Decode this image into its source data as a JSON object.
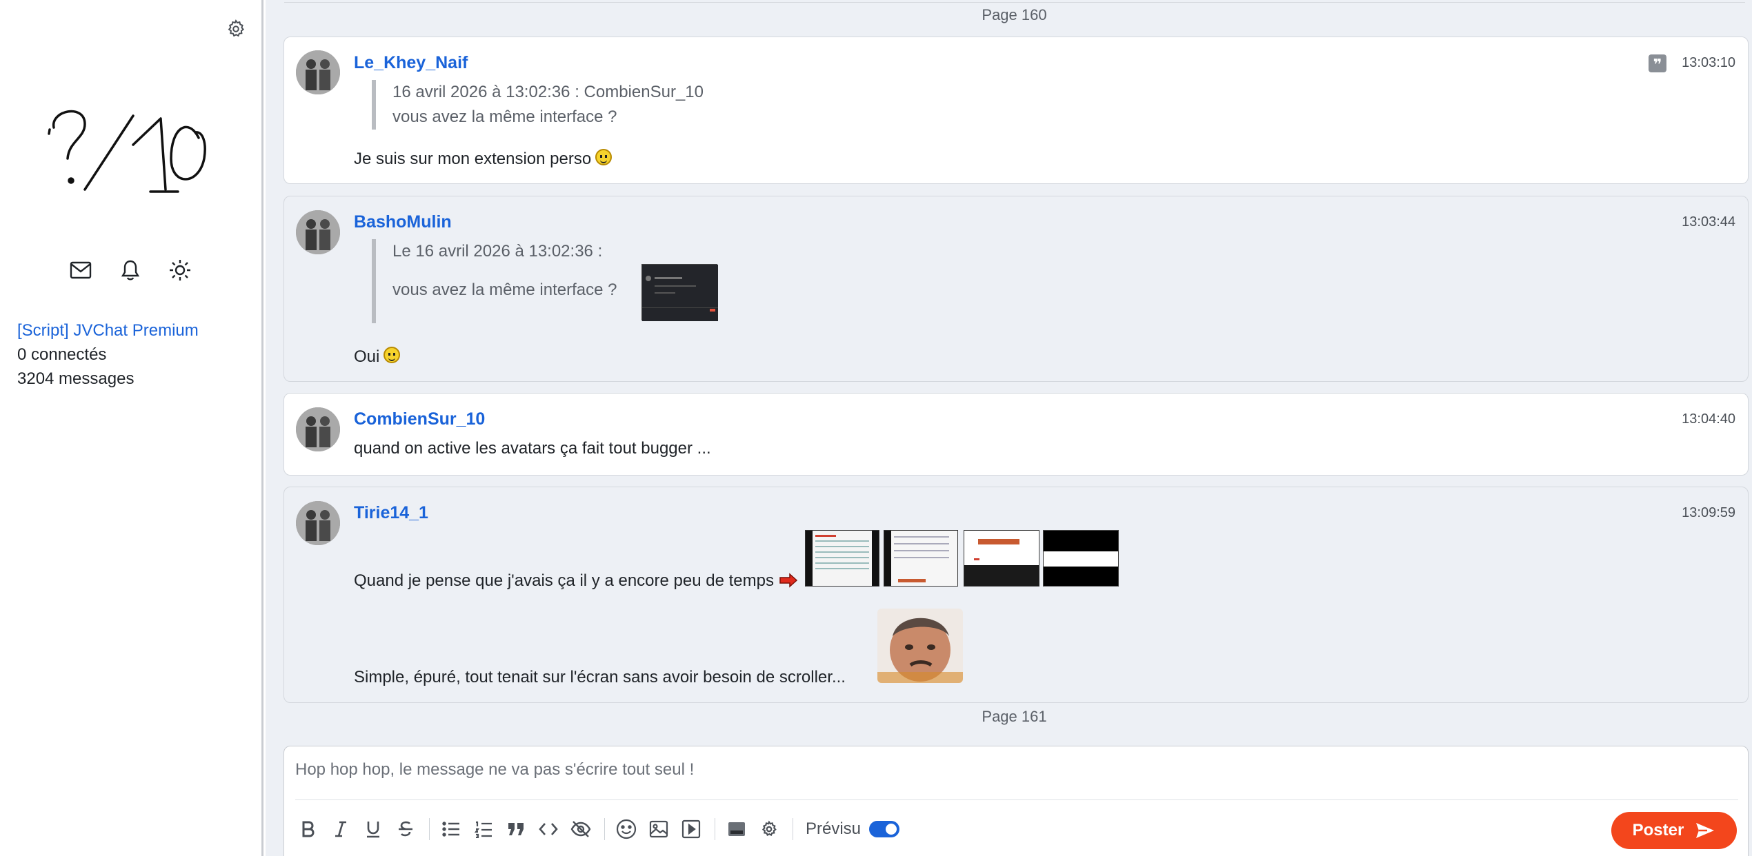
{
  "sidebar": {
    "logo_text": "?/10",
    "icons": [
      "mail-icon",
      "bell-icon",
      "sun-icon"
    ],
    "topic_link": "[Script] JVChat Premium",
    "connected": "0 connectés",
    "messages_count": "3204 messages"
  },
  "pages": {
    "top": "Page 160",
    "bottom": "Page 161"
  },
  "messages": [
    {
      "author": "Le_Khey_Naif",
      "time": "13:03:10",
      "quote_header": "16 avril 2026 à 13:02:36 : CombienSur_10",
      "quote_text": "vous avez la même interface ?",
      "text": "Je suis sur mon extension perso"
    },
    {
      "author": "BashoMulin",
      "time": "13:03:44",
      "quote_header": "Le 16 avril 2026 à 13:02:36 :",
      "quote_text": "vous avez la même interface ?",
      "text": "Oui"
    },
    {
      "author": "CombienSur_10",
      "time": "13:04:40",
      "text": "quand on active les avatars ça fait tout bugger ..."
    },
    {
      "author": "Tirie14_1",
      "time": "13:09:59",
      "text": "Quand je pense que j'avais ça il y a encore peu de temps",
      "text2": "Simple, épuré, tout tenait sur l'écran sans avoir besoin de scroller..."
    }
  ],
  "composer": {
    "placeholder": "Hop hop hop, le message ne va pas s'écrire tout seul !",
    "preview_label": "Prévisu",
    "preview_enabled": true,
    "post_label": "Poster"
  },
  "colors": {
    "link": "#1a63d9",
    "post_button": "#f3461c",
    "background": "#edf0f5"
  }
}
